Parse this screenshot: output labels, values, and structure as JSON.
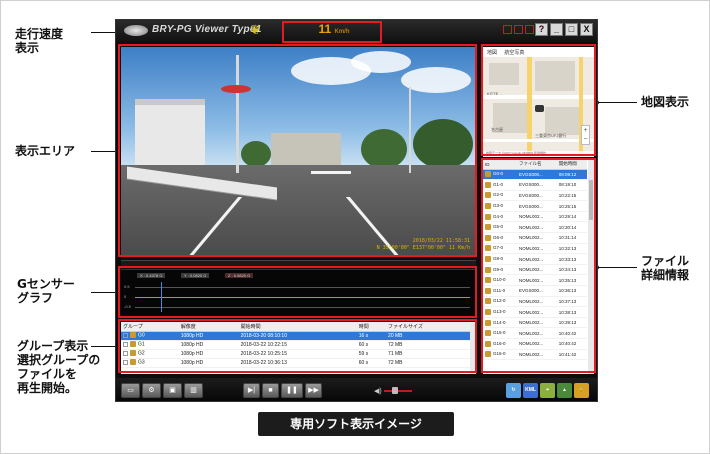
{
  "annotations": {
    "speed": "走行速度\n表示",
    "display_area": "表示エリア",
    "g_sensor": "Gセンサー\nグラフ",
    "group": "グループ表示\n選択グループの\nファイルを\n再生開始。",
    "map": "地図表示",
    "file": "ファイル\n詳細情報"
  },
  "app": {
    "title": "BRY-PG Viewer Type1",
    "speed_value": "11",
    "speed_unit": "Km/h",
    "win_help": "?",
    "win_min": "_",
    "win_max": "□",
    "win_close": "X"
  },
  "video": {
    "osd_line1": "2018/03/22 11:58:31",
    "osd_line2": "N 35°00'00\" E137°00'00\" 11 Km/h"
  },
  "gsensor": {
    "chip_x": "X : 0.4378 G",
    "chip_y": "Y : 0.0820 G",
    "chip_z": "Z : 0.9820 G",
    "axis_top": "0.5",
    "axis_mid": "0",
    "axis_bot": "-0.5"
  },
  "group_list": {
    "headers": [
      "グループ",
      "解像度",
      "開始時間",
      "時間",
      "ファイルサイズ"
    ],
    "rows": [
      {
        "group": "G0",
        "resolution": "1080p HD",
        "start": "2018-03-20 08:10:10",
        "duration": "16 s",
        "size": "20 MB"
      },
      {
        "group": "G1",
        "resolution": "1080p HD",
        "start": "2018-03-22 10:22:15",
        "duration": "60 s",
        "size": "72 MB"
      },
      {
        "group": "G2",
        "resolution": "1080p HD",
        "start": "2018-03-22 10:25:15",
        "duration": "59 s",
        "size": "71 MB"
      },
      {
        "group": "G3",
        "resolution": "1080p HD",
        "start": "2018-03-22 10:36:13",
        "duration": "60 s",
        "size": "72 MB"
      }
    ]
  },
  "map": {
    "tab_map": "地図",
    "tab_satellite": "航空写真",
    "label1": "KITTE",
    "label2": "三重東京UFJ銀行",
    "label3": "名古屋",
    "footer": "地図データ ©2017 Google ZENRIN 利用規約",
    "zoom_in": "+",
    "zoom_out": "−"
  },
  "file_list": {
    "headers": [
      "ID",
      "ファイル名",
      "開始時間"
    ],
    "rows": [
      {
        "id": "G0-0",
        "name": "EVGS000...",
        "start": "08:09:12"
      },
      {
        "id": "G1-0",
        "name": "EVGS000...",
        "start": "08:19:10"
      },
      {
        "id": "G2-0",
        "name": "EVGS000...",
        "start": "10:22:15"
      },
      {
        "id": "G3-0",
        "name": "EVGS000...",
        "start": "10:25:15"
      },
      {
        "id": "G4-0",
        "name": "NOML002...",
        "start": "10:29:14"
      },
      {
        "id": "G5-0",
        "name": "NOML002...",
        "start": "10:30:14"
      },
      {
        "id": "G6-0",
        "name": "NOML002...",
        "start": "10:31:14"
      },
      {
        "id": "G7-0",
        "name": "NOML002...",
        "start": "10:32:13"
      },
      {
        "id": "G8-0",
        "name": "NOML002...",
        "start": "10:33:13"
      },
      {
        "id": "G9-0",
        "name": "NOML002...",
        "start": "10:34:13"
      },
      {
        "id": "G10-0",
        "name": "NOML002...",
        "start": "10:35:13"
      },
      {
        "id": "G11-0",
        "name": "EVGS000...",
        "start": "10:36:13"
      },
      {
        "id": "G12-0",
        "name": "NOML002...",
        "start": "10:37:13"
      },
      {
        "id": "G13-0",
        "name": "NOML002...",
        "start": "10:38:13"
      },
      {
        "id": "G14-0",
        "name": "NOML002...",
        "start": "10:39:13"
      },
      {
        "id": "G15-0",
        "name": "NOML002...",
        "start": "10:40:42"
      },
      {
        "id": "G16-0",
        "name": "NOML002...",
        "start": "10:40:42"
      },
      {
        "id": "G16-0",
        "name": "NOML002...",
        "start": "10:41:42"
      }
    ]
  },
  "controls": {
    "kml_label": "KML"
  },
  "caption": "専用ソフト表示イメージ"
}
